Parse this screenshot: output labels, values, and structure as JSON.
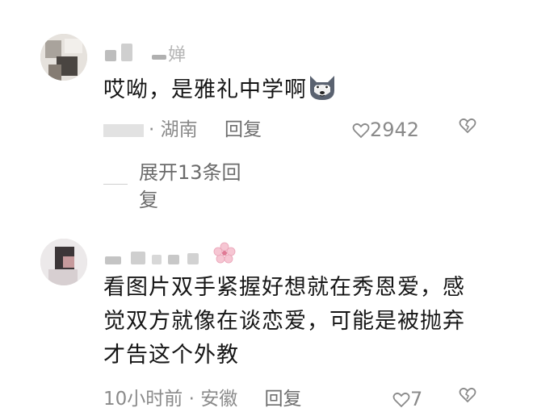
{
  "comments": [
    {
      "username_suffix": "婵",
      "text": "哎呦，是雅礼中学啊",
      "emoji": "wolf-dog-emoji",
      "location": "湖南",
      "reply_label": "回复",
      "likes": "2942",
      "expand_label": "展开13条回复"
    },
    {
      "text": "看图片双手紧握好想就在秀恩爱，感觉双方就像在谈恋爱，可能是被抛弃才告这个外教",
      "time": "10小时前",
      "location": "安徽",
      "reply_label": "回复",
      "likes": "7",
      "name_emoji": "cherry-blossom-emoji"
    }
  ],
  "separator": "·",
  "colors": {
    "meta": "#8a8a8a",
    "text": "#161616",
    "bg": "#ffffff"
  }
}
